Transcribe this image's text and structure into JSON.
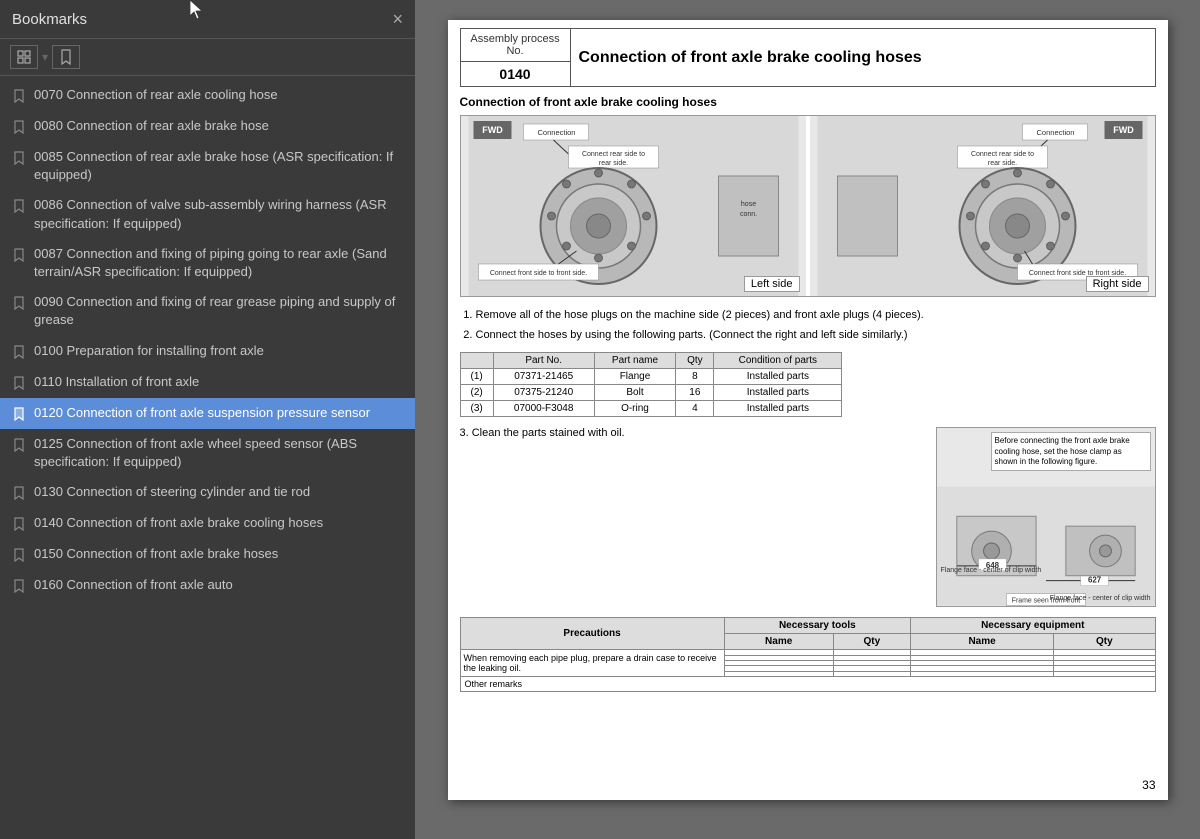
{
  "bookmarks": {
    "title": "Bookmarks",
    "close_label": "×",
    "items": [
      {
        "id": "bm0070",
        "label": "0070 Connection of rear axle cooling hose",
        "active": false
      },
      {
        "id": "bm0080",
        "label": "0080 Connection of rear axle brake hose",
        "active": false
      },
      {
        "id": "bm0085",
        "label": "0085 Connection of rear axle brake hose (ASR specification: If equipped)",
        "active": false
      },
      {
        "id": "bm0086",
        "label": "0086 Connection of valve sub-assembly wiring harness (ASR specification: If equipped)",
        "active": false
      },
      {
        "id": "bm0087",
        "label": "0087 Connection and fixing of piping going to rear axle (Sand terrain/ASR specification: If equipped)",
        "active": false
      },
      {
        "id": "bm0090",
        "label": "0090 Connection and fixing of rear grease piping and supply of grease",
        "active": false
      },
      {
        "id": "bm0100",
        "label": "0100 Preparation for installing front axle",
        "active": false
      },
      {
        "id": "bm0110",
        "label": "0110 Installation of front axle",
        "active": false
      },
      {
        "id": "bm0120",
        "label": "0120 Connection of front axle suspension pressure sensor",
        "active": true
      },
      {
        "id": "bm0125",
        "label": "0125 Connection of front axle wheel speed sensor (ABS specification: If equipped)",
        "active": false
      },
      {
        "id": "bm0130",
        "label": "0130 Connection of steering cylinder and tie rod",
        "active": false
      },
      {
        "id": "bm0140",
        "label": "0140 Connection of front axle brake cooling hoses",
        "active": false
      },
      {
        "id": "bm0150",
        "label": "0150 Connection of front axle brake hoses",
        "active": false
      },
      {
        "id": "bm0160",
        "label": "0160 Connection of front axle auto",
        "active": false
      }
    ]
  },
  "toolbar": {
    "btn1_label": "⊞",
    "btn2_label": "🔖"
  },
  "document": {
    "process_no_label": "Assembly process No.",
    "process_no_value": "0140",
    "title": "Connection of front axle brake cooling hoses",
    "section_title": "Connection of front axle brake cooling hoses",
    "left_side_label": "Left side",
    "right_side_label": "Right side",
    "instructions": [
      "Remove all of the hose plugs on the machine side (2 pieces) and front axle plugs (4 pieces).",
      "Connect the hoses by using the following parts.  (Connect the right and left side similarly.)"
    ],
    "parts_table": {
      "headers": [
        "",
        "Part No.",
        "Part name",
        "Qty",
        "Condition of parts"
      ],
      "rows": [
        [
          "(1)",
          "07371-21465",
          "Flange",
          "8",
          "Installed parts"
        ],
        [
          "(2)",
          "07375-21240",
          "Bolt",
          "16",
          "Installed parts"
        ],
        [
          "(3)",
          "07000-F3048",
          "O-ring",
          "4",
          "Installed parts"
        ]
      ]
    },
    "clean_note": "3.  Clean the parts stained with oil.",
    "diagram_note": "Before connecting the front axle brake cooling hose, set the hose clamp as shown in the following figure.",
    "diagram_values": {
      "val1": "648",
      "val2": "627",
      "label1": "Flange face - center of clip width",
      "label2": "Frame seen from front",
      "label3": "Flange face - center of clip width"
    },
    "bottom_table": {
      "headers": [
        "Precautions",
        "Necessary tools",
        "Necessary equipment"
      ],
      "sub_headers": [
        "",
        "Name",
        "Qty",
        "Name",
        "Qty"
      ],
      "precaution": "When removing each pipe plug, prepare a drain case to receive the leaking oil.",
      "other_remarks": "Other remarks"
    },
    "page_number": "33"
  }
}
